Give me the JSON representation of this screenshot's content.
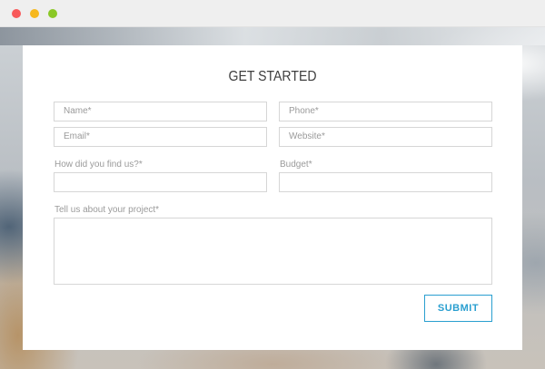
{
  "window": {
    "controls": [
      "close",
      "minimize",
      "maximize"
    ]
  },
  "form": {
    "title": "GET STARTED",
    "fields": {
      "name": {
        "placeholder": "Name*"
      },
      "phone": {
        "placeholder": "Phone*"
      },
      "email": {
        "placeholder": "Email*"
      },
      "website": {
        "placeholder": "Website*"
      },
      "find_us": {
        "label": "How did you find us?*",
        "value": ""
      },
      "budget": {
        "label": "Budget*",
        "value": ""
      },
      "project": {
        "label": "Tell us about your project*",
        "value": ""
      }
    },
    "submit_label": "SUBMIT"
  },
  "colors": {
    "accent": "#2a9fd0",
    "close": "#f8595a",
    "minimize": "#f6b81e",
    "maximize": "#8ac826"
  }
}
